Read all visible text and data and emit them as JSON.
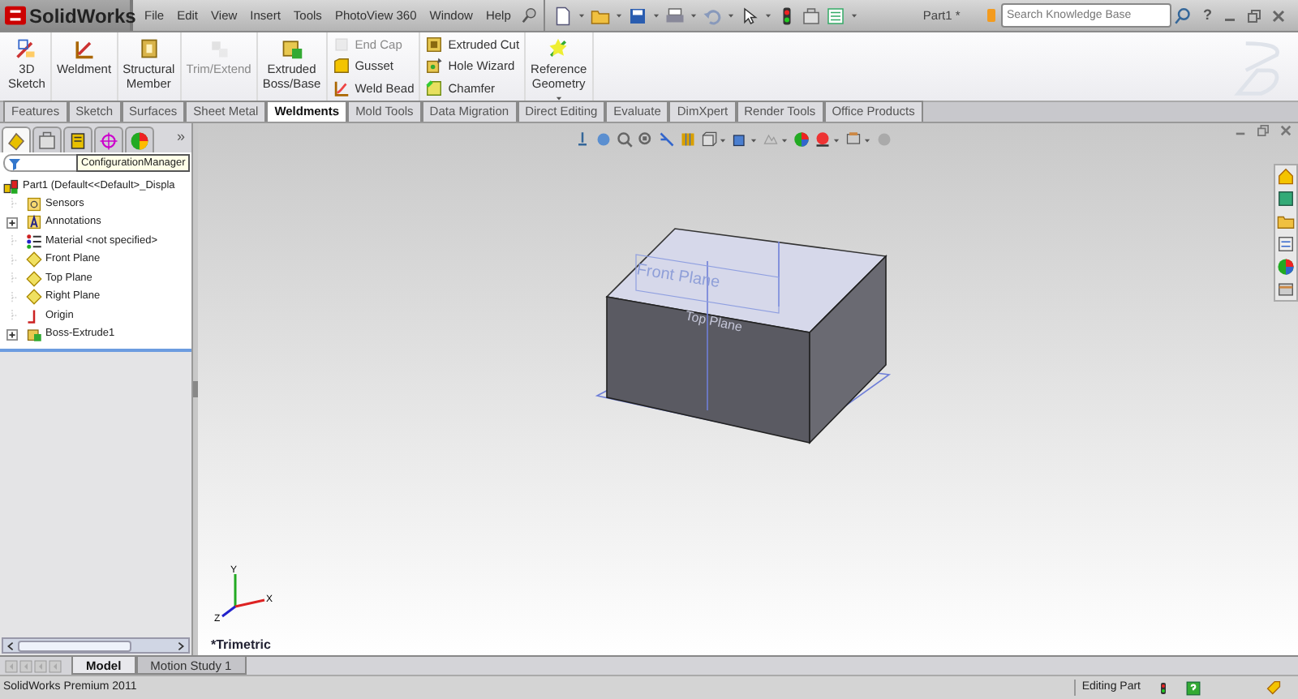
{
  "app": {
    "logo": "SolidWorks",
    "menus": [
      "File",
      "Edit",
      "View",
      "Insert",
      "Tools",
      "PhotoView 360",
      "Window",
      "Help"
    ],
    "document_title": "Part1 *",
    "search": {
      "placeholder": "Search Knowledge Base"
    },
    "help_button": "?"
  },
  "ribbon": {
    "groups": [
      {
        "kind": "big",
        "items": [
          {
            "label": "3D Sketch",
            "disabled": false
          }
        ]
      },
      {
        "kind": "big",
        "items": [
          {
            "label": "Weldment",
            "disabled": false
          }
        ]
      },
      {
        "kind": "big",
        "items": [
          {
            "label": "Structural Member",
            "disabled": false
          }
        ]
      },
      {
        "kind": "big",
        "items": [
          {
            "label": "Trim/Extend",
            "disabled": true
          }
        ]
      },
      {
        "kind": "big",
        "items": [
          {
            "label": "Extruded Boss/Base",
            "disabled": false
          }
        ]
      },
      {
        "kind": "small",
        "items": [
          {
            "label": "End Cap",
            "disabled": true
          },
          {
            "label": "Gusset",
            "disabled": false
          },
          {
            "label": "Weld Bead",
            "disabled": false
          }
        ]
      },
      {
        "kind": "small",
        "items": [
          {
            "label": "Extruded Cut",
            "disabled": false
          },
          {
            "label": "Hole Wizard",
            "disabled": false
          },
          {
            "label": "Chamfer",
            "disabled": false
          }
        ]
      },
      {
        "kind": "big",
        "items": [
          {
            "label": "Reference Geometry",
            "disabled": false
          }
        ]
      }
    ]
  },
  "tabs": [
    {
      "label": "Features",
      "selected": false
    },
    {
      "label": "Sketch",
      "selected": false
    },
    {
      "label": "Surfaces",
      "selected": false
    },
    {
      "label": "Sheet Metal",
      "selected": false
    },
    {
      "label": "Weldments",
      "selected": true
    },
    {
      "label": "Mold Tools",
      "selected": false
    },
    {
      "label": "Data Migration",
      "selected": false
    },
    {
      "label": "Direct Editing",
      "selected": false
    },
    {
      "label": "Evaluate",
      "selected": false
    },
    {
      "label": "DimXpert",
      "selected": false
    },
    {
      "label": "Render Tools",
      "selected": false
    },
    {
      "label": "Office Products",
      "selected": false
    }
  ],
  "feature_manager": {
    "panel_tabs": [
      {
        "selected": true
      },
      {
        "selected": false
      },
      {
        "selected": false
      },
      {
        "selected": false
      },
      {
        "selected": false
      }
    ],
    "more": "»",
    "tooltip": "ConfigurationManager",
    "tree": {
      "label": "Part1  (Default<<Default>_Displa",
      "children": [
        {
          "label": "Sensors",
          "expandable": false
        },
        {
          "label": "Annotations",
          "expandable": true
        },
        {
          "label": "Material <not specified>",
          "expandable": false
        },
        {
          "label": "Front Plane",
          "expandable": false
        },
        {
          "label": "Top Plane",
          "expandable": false
        },
        {
          "label": "Right Plane",
          "expandable": false
        },
        {
          "label": "Origin",
          "expandable": false
        },
        {
          "label": "Boss-Extrude1",
          "expandable": true
        }
      ]
    }
  },
  "viewport": {
    "plane_labels": [
      "Front Plane",
      "Top Plane"
    ],
    "triad": {
      "x": "X",
      "y": "Y",
      "z": "Z"
    },
    "view_name": "*Trimetric"
  },
  "bottom_tabs": [
    {
      "label": "Model",
      "selected": true
    },
    {
      "label": "Motion Study 1",
      "selected": false
    }
  ],
  "status_bar": {
    "product": "SolidWorks Premium 2011",
    "mode": "Editing Part"
  }
}
